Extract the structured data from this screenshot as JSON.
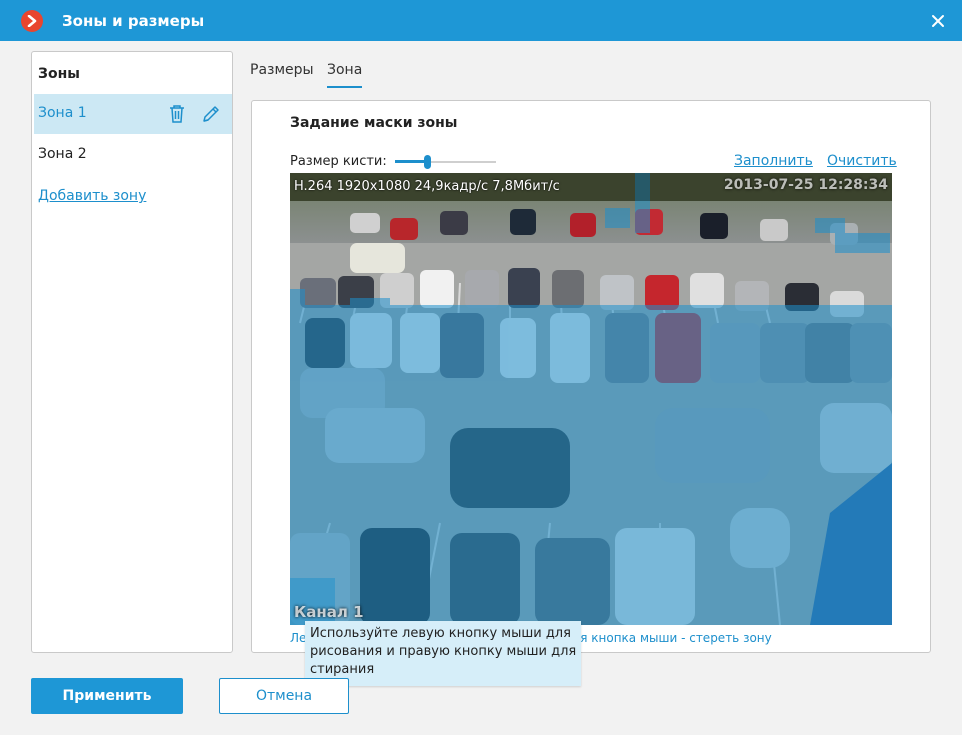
{
  "window": {
    "title": "Зоны и размеры"
  },
  "zones": {
    "header": "Зоны",
    "items": [
      {
        "label": "Зона 1"
      },
      {
        "label": "Зона 2"
      }
    ],
    "add_label": "Добавить зону"
  },
  "tabs": [
    {
      "label": "Размеры"
    },
    {
      "label": "Зона"
    }
  ],
  "mask": {
    "title": "Задание маски зоны",
    "brush_label": "Размер кисти:",
    "brush_level": 0.32,
    "fill_label": "Заполнить",
    "clear_label": "Очистить",
    "hint": "Левая кнопка мыши - нарисовать зону, правая кнопка мыши - стереть зону"
  },
  "video": {
    "osd": "H.264 1920x1080 24,9кадр/с 7,8Мбит/с",
    "timestamp": "2013-07-25 12:28:34",
    "channel": "Канал 1"
  },
  "tooltip": "Используйте левую кнопку мыши для рисования и правую кнопку мыши для стирания",
  "buttons": {
    "apply": "Применить",
    "cancel": "Отмена"
  },
  "colors": {
    "accent": "#1e97d6",
    "link": "#1d8fcc",
    "selection": "#cce8f4",
    "mask": "#1d8fcc"
  }
}
